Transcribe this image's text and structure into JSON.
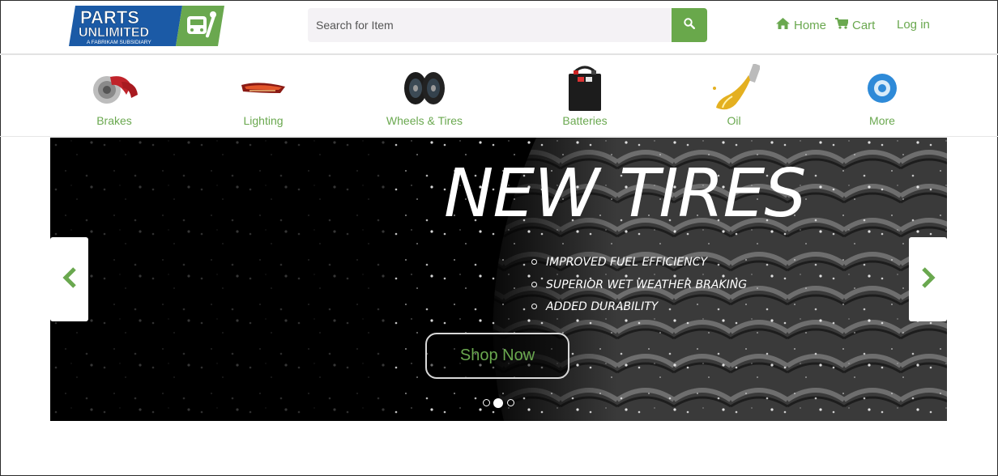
{
  "brand": {
    "logo_line1": "PARTS",
    "logo_line2": "UNLIMITED",
    "logo_tagline": "A FABRIKAM SUBSIDIARY",
    "accent": "#6aa84f",
    "logo_blue": "#1b5aa6"
  },
  "search": {
    "placeholder": "Search for Item",
    "icon": "search-icon"
  },
  "nav": {
    "home": "Home",
    "cart": "Cart",
    "login": "Log in"
  },
  "categories": [
    {
      "label": "Brakes",
      "icon": "brake-icon"
    },
    {
      "label": "Lighting",
      "icon": "tail-light-icon"
    },
    {
      "label": "Wheels & Tires",
      "icon": "wheel-icon"
    },
    {
      "label": "Batteries",
      "icon": "battery-icon"
    },
    {
      "label": "Oil",
      "icon": "oil-icon"
    },
    {
      "label": "More",
      "icon": "more-icon"
    }
  ],
  "hero": {
    "title": "NEW TIRES",
    "features": [
      "IMPROVED FUEL EFFICIENCY",
      "SUPERIOR WET WEATHER BRAKING",
      "ADDED DURABILITY"
    ],
    "cta": "Shop Now",
    "slides_total": 3,
    "active_slide": 2
  }
}
